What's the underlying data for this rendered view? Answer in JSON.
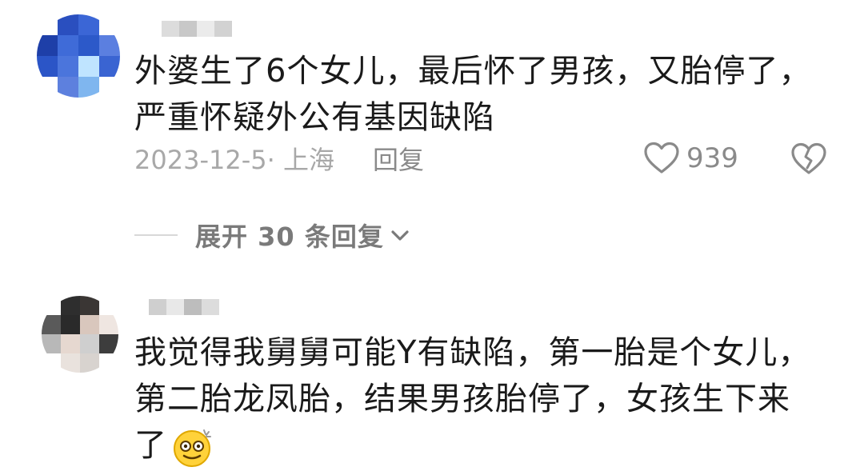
{
  "comments": [
    {
      "avatar_colors": [
        "#ffffff",
        "#2a4fbf",
        "#3b66d6",
        "#ffffff",
        "#1e3fa8",
        "#3f6bd8",
        "#2c59c9",
        "#5b7fe0",
        "#2b55c7",
        "#4b75dc",
        "#bfe4ff",
        "#3a64d2",
        "#ffffff",
        "#5d80de",
        "#7fb6ef",
        "#ffffff"
      ],
      "username_colors": [
        "#dcdcdc",
        "#c8c8c8",
        "#ebebeb",
        "#d2d2d2"
      ],
      "text": "外婆生了6个女儿，最后怀了男孩，又胎停了，严重怀疑外公有基因缺陷",
      "date_location": "2023-12-5· 上海",
      "reply_label": "回复",
      "like_count": "939",
      "expand_label": "展开 30 条回复"
    },
    {
      "avatar_colors": [
        "#ffffff",
        "#2e2e2e",
        "#3a3634",
        "#ffffff",
        "#5a5a5a",
        "#2a2a2a",
        "#d9c7bd",
        "#efe6e1",
        "#b8b8b8",
        "#e6d8d0",
        "#cfcfcf",
        "#3d3d3d",
        "#ffffff",
        "#e9e2dd",
        "#d8d3cf",
        "#ffffff"
      ],
      "username_colors": [
        "#cfcfcf",
        "#e8e8e8",
        "#bdbdbd",
        "#dcdcdc"
      ],
      "text": "我觉得我舅舅可能Y有缺陷，第一胎是个女儿，第二胎龙凤胎，结果男孩胎停了，女孩生下来了"
    }
  ],
  "icons": {
    "like": "heart-outline-icon",
    "dislike": "broken-heart-icon",
    "expand": "chevron-down-icon",
    "emoji": "dizzy-face-emoji"
  }
}
